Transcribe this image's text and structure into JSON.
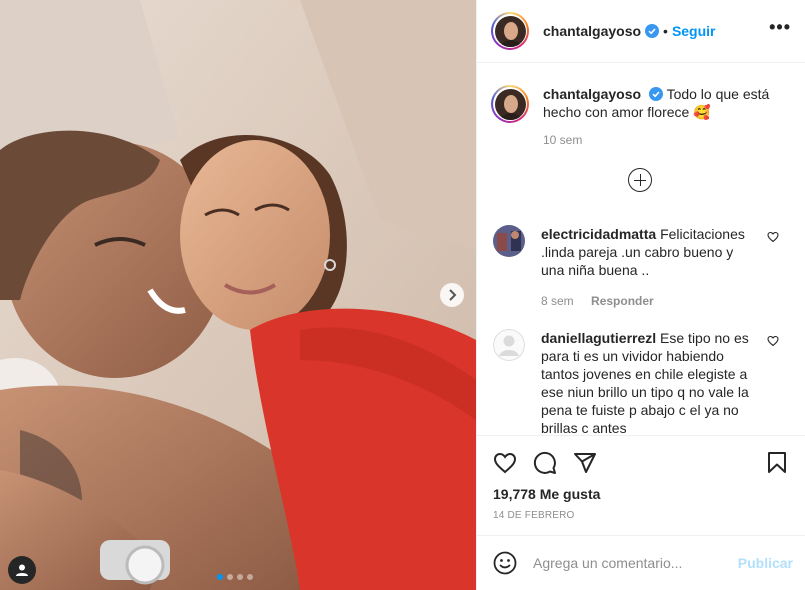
{
  "post": {
    "username": "chantalgayoso",
    "follow_label": "Seguir",
    "more_label": "•••",
    "separator": "•"
  },
  "caption": {
    "username": "chantalgayoso",
    "text": "Todo lo que está hecho con amor florece 🥰",
    "time": "10 sem"
  },
  "comments": [
    {
      "username": "electricidadmatta",
      "text": "Felicitaciones .linda pareja .un cabro bueno y una niña buena ..",
      "time": "8 sem",
      "reply_label": "Responder"
    },
    {
      "username": "daniellagutierrezl",
      "text": "Ese tipo no es para ti es un vividor habiendo tantos jovenes en chile elegiste a ese niun brillo un tipo q no vale la pena te fuiste p abajo c el ya no brillas c antes",
      "time": "",
      "reply_label": ""
    }
  ],
  "stats": {
    "likes": "19,778 Me gusta",
    "date": "14 de febrero"
  },
  "composer": {
    "placeholder": "Agrega un comentario...",
    "publish_label": "Publicar"
  },
  "carousel": {
    "slides": 4,
    "active": 0
  },
  "colors": {
    "accent": "#0095f6",
    "publish_disabled": "#b2dffc",
    "muted": "#8e8e8e"
  },
  "icons": [
    "chevron-right-icon",
    "user-tag-icon",
    "verified-icon",
    "more-icon",
    "add-circle-icon",
    "heart-icon",
    "comment-icon",
    "share-icon",
    "bookmark-icon",
    "emoji-icon"
  ]
}
